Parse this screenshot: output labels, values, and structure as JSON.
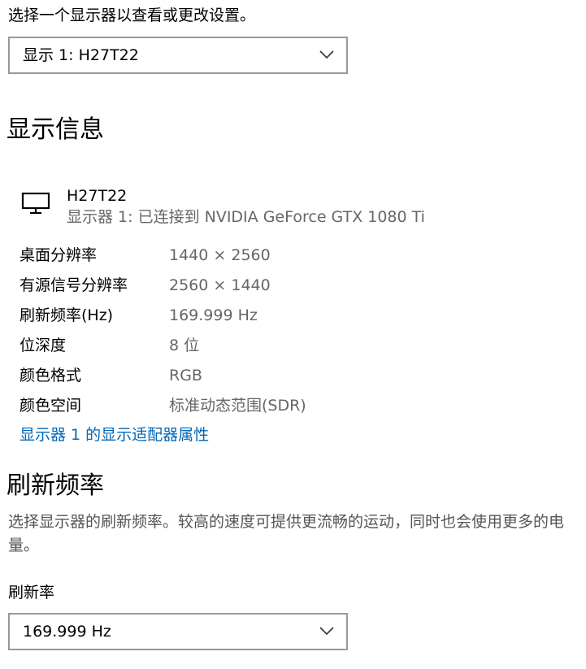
{
  "display_select": {
    "prompt": "选择一个显示器以查看或更改设置。",
    "selected": "显示 1: H27T22"
  },
  "display_info": {
    "section_title": "显示信息",
    "monitor_name": "H27T22",
    "monitor_subtitle": "显示器 1: 已连接到 NVIDIA GeForce GTX 1080 Ti",
    "rows": [
      {
        "label": "桌面分辨率",
        "value": "1440 × 2560"
      },
      {
        "label": "有源信号分辨率",
        "value": "2560 × 1440"
      },
      {
        "label": "刷新频率(Hz)",
        "value": "169.999 Hz"
      },
      {
        "label": "位深度",
        "value": "8 位"
      },
      {
        "label": "颜色格式",
        "value": "RGB"
      },
      {
        "label": "颜色空间",
        "value": "标准动态范围(SDR)"
      }
    ],
    "adapter_link": "显示器 1 的显示适配器属性"
  },
  "refresh_rate": {
    "section_title": "刷新频率",
    "description": "选择显示器的刷新频率。较高的速度可提供更流畅的运动，同时也会使用更多的电量。",
    "field_label": "刷新率",
    "selected": "169.999 Hz"
  },
  "colors": {
    "link": "#0067b8",
    "secondary_text": "#666666",
    "border": "#999999"
  },
  "icons": {
    "monitor": "monitor-icon",
    "dropdown": "chevron-down-icon"
  }
}
